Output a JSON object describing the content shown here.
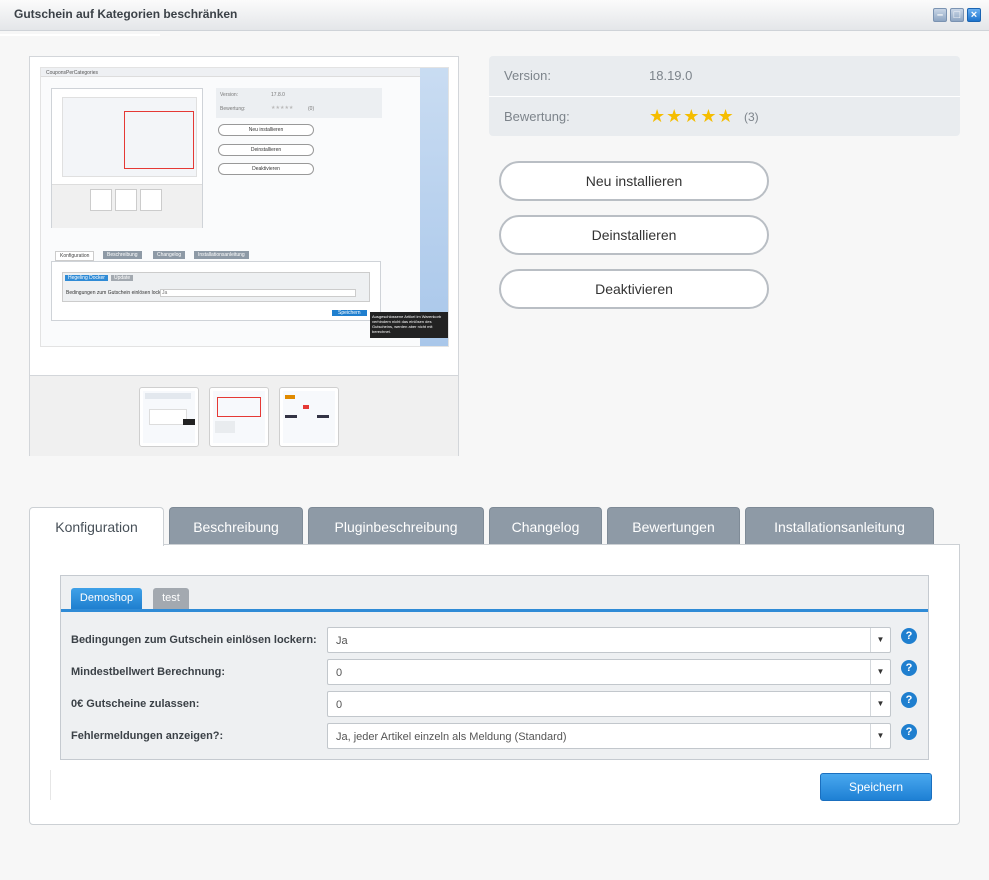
{
  "window": {
    "title": "Gutschein auf Kategorien beschränken",
    "controls": [
      "minimize",
      "maximize",
      "close"
    ]
  },
  "preview": {
    "main_image": {
      "title": "CouponsPerCategories",
      "buttons": [
        "Neu installieren",
        "Deinstallieren",
        "Deaktivieren"
      ],
      "tabs": [
        "Konfiguration",
        "Beschreibung",
        "Changelog",
        "Installationsanleitung"
      ],
      "subtabs": [
        "Hegeling Docker",
        "Update"
      ],
      "field_label": "Bedingungen zum Gutschein einlösen lockern:",
      "field_value": "Ja",
      "save_label": "Speichern",
      "tooltip": "Ausgeschlossene Artikel im Warenkorb verhindern nicht das einlösen des Gutscheins, werden aber nicht mit berechnet.",
      "info": {
        "version_label": "Version:",
        "version_value": "17.8.0",
        "rating_label": "Bewertung:",
        "rating_stars": "★★★★★",
        "rating_count": "(0)"
      }
    },
    "thumbnails": [
      "screenshot-1",
      "screenshot-2",
      "screenshot-3"
    ]
  },
  "info": {
    "version_label": "Version:",
    "version_value": "18.19.0",
    "rating_label": "Bewertung:",
    "rating_stars": "★★★★★",
    "rating_value": 5,
    "rating_count": "(3)"
  },
  "actions": {
    "reinstall": "Neu installieren",
    "uninstall": "Deinstallieren",
    "deactivate": "Deaktivieren"
  },
  "tabs": [
    "Konfiguration",
    "Beschreibung",
    "Pluginbeschreibung",
    "Changelog",
    "Bewertungen",
    "Installationsanleitung"
  ],
  "config": {
    "shop_tabs": [
      "Demoshop",
      "test"
    ],
    "fields": [
      {
        "label": "Bedingungen zum Gutschein einlösen lockern:",
        "value": "Ja"
      },
      {
        "label": "Mindestbellwert Berechnung:",
        "value": "0"
      },
      {
        "label": "0€ Gutscheine zulassen:",
        "value": "0"
      },
      {
        "label": "Fehlermeldungen anzeigen?:",
        "value": "Ja, jeder Artikel einzeln als Meldung (Standard)"
      }
    ],
    "help_glyph": "?",
    "dropdown_glyph": "▼",
    "save_label": "Speichern"
  },
  "colors": {
    "accent": "#1f7fcf",
    "star": "#f5bd00",
    "tab_inactive": "#8e9aa6"
  }
}
